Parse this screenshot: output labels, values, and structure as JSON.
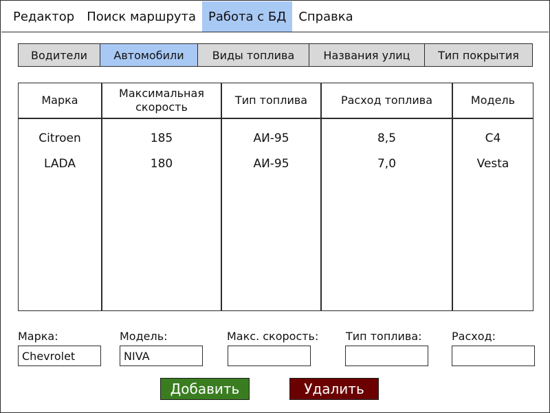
{
  "menu": {
    "items": [
      {
        "label": "Редактор"
      },
      {
        "label": "Поиск маршрута"
      },
      {
        "label": "Работа с БД"
      },
      {
        "label": "Справка"
      }
    ],
    "active_index": 2,
    "active_color": "#a9c9f5"
  },
  "tabs": {
    "items": [
      {
        "label": "Водители"
      },
      {
        "label": "Автомобили"
      },
      {
        "label": "Виды топлива"
      },
      {
        "label": "Названия улиц"
      },
      {
        "label": "Тип покрытия"
      }
    ],
    "active_index": 1
  },
  "table": {
    "headers": [
      "Марка",
      "Максимальная скорость",
      "Тип топлива",
      "Расход топлива",
      "Модель"
    ],
    "rows": [
      [
        "Citroen",
        "185",
        "АИ-95",
        "8,5",
        "C4"
      ],
      [
        "LADA",
        "180",
        "АИ-95",
        "7,0",
        "Vesta"
      ]
    ]
  },
  "form": {
    "brand_label": "Марка:",
    "brand_value": "Chevrolet",
    "model_label": "Модель:",
    "model_value": "NIVA",
    "speed_label": "Макс. скорость:",
    "speed_value": "",
    "fuel_label": "Тип топлива:",
    "fuel_value": "",
    "consumption_label": "Расход:",
    "consumption_value": ""
  },
  "buttons": {
    "add_label": "Добавить",
    "add_color": "#3a7d21",
    "delete_label": "Удалить",
    "delete_color": "#6b0000"
  }
}
